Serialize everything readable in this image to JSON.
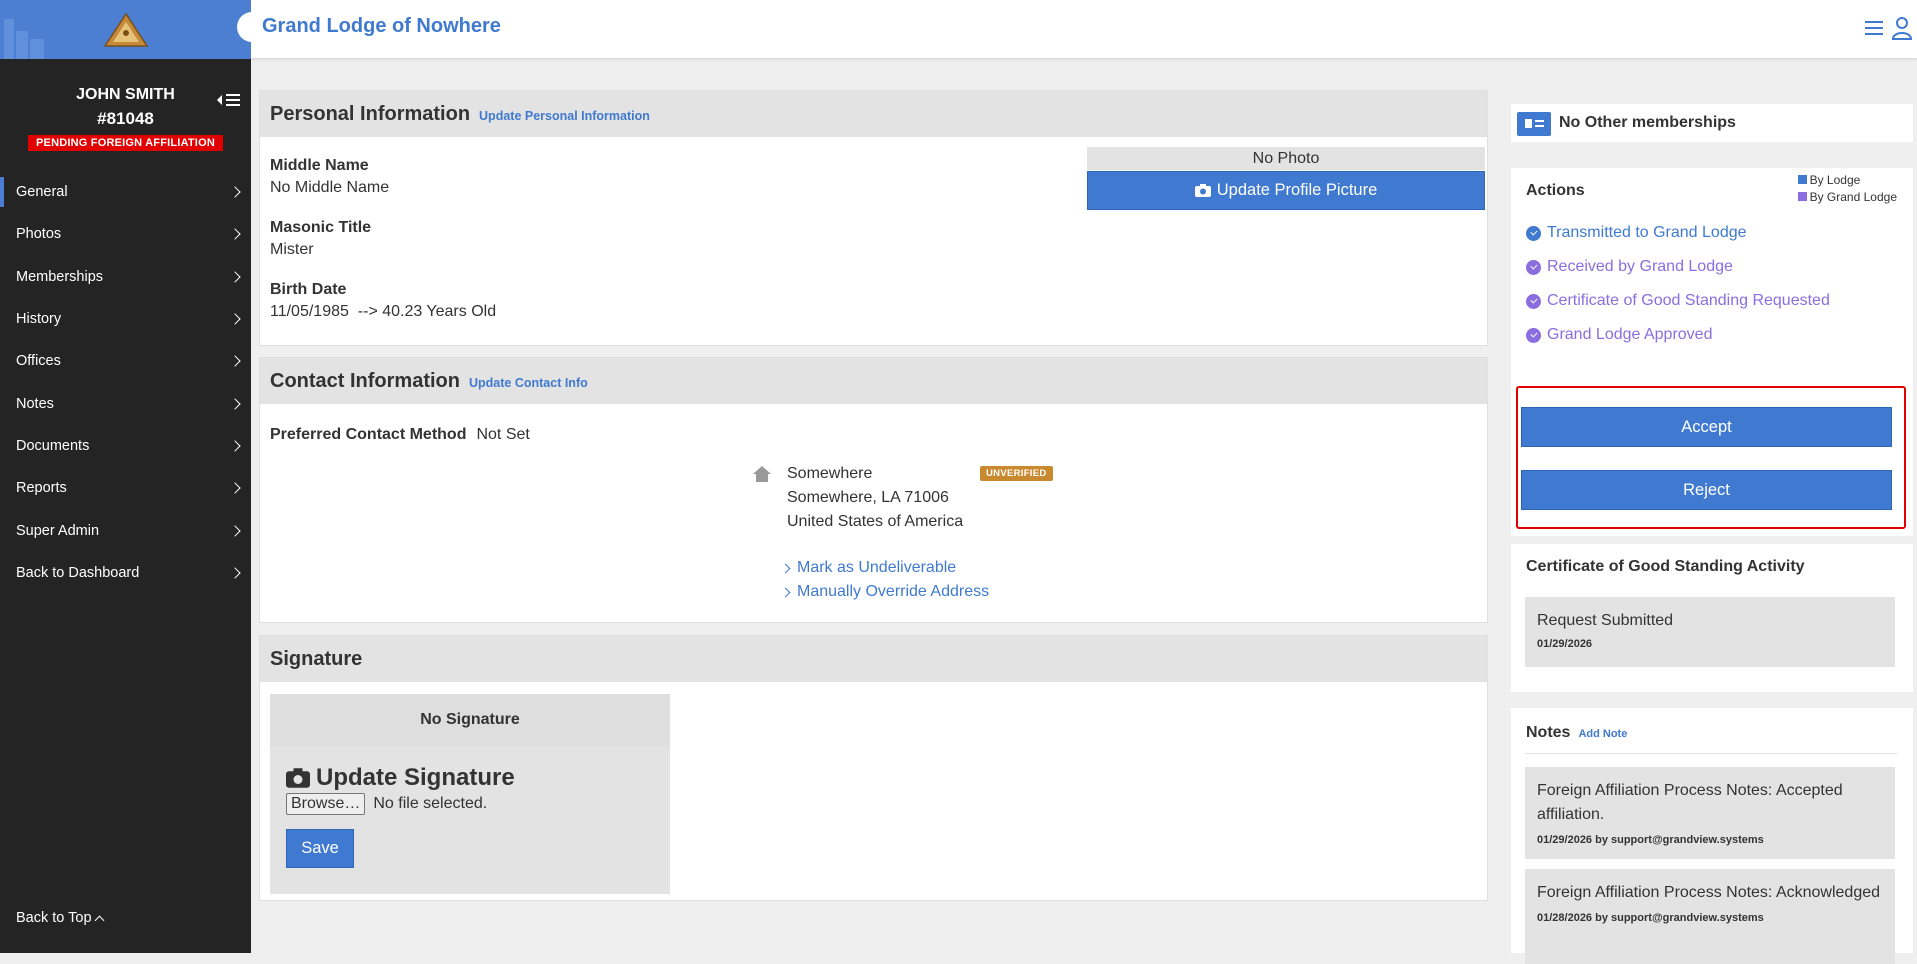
{
  "header": {
    "title": "Grand Lodge of Nowhere"
  },
  "user": {
    "name": "JOHN SMITH",
    "number": "#81048",
    "status_badge": "PENDING FOREIGN AFFILIATION"
  },
  "nav": [
    {
      "label": "General",
      "active": true
    },
    {
      "label": "Photos"
    },
    {
      "label": "Memberships"
    },
    {
      "label": "History"
    },
    {
      "label": "Offices"
    },
    {
      "label": "Notes"
    },
    {
      "label": "Documents"
    },
    {
      "label": "Reports"
    },
    {
      "label": "Super Admin"
    },
    {
      "label": "Back to Dashboard"
    }
  ],
  "back_to_top": "Back to Top",
  "personal": {
    "title": "Personal Information",
    "update_link": "Update Personal Information",
    "middle_name_label": "Middle Name",
    "middle_name_value": "No Middle Name",
    "masonic_title_label": "Masonic Title",
    "masonic_title_value": "Mister",
    "birth_date_label": "Birth Date",
    "birth_date_value": "11/05/1985  --> 40.23 Years Old",
    "photo_label": "No Photo",
    "photo_button": "Update Profile Picture"
  },
  "contact": {
    "title": "Contact Information",
    "update_link": "Update Contact Info",
    "preferred_label": "Preferred Contact Method",
    "preferred_value": "Not Set",
    "address_line1": "Somewhere",
    "address_line2": "Somewhere, LA 71006",
    "address_line3": "United States of America",
    "address_badge": "UNVERIFIED",
    "mark_undeliverable": "Mark as Undeliverable",
    "override_address": "Manually Override Address"
  },
  "signature": {
    "title": "Signature",
    "none_label": "No Signature",
    "update_label": "Update Signature",
    "browse_label": "Browse…",
    "file_status": "No file selected.",
    "save_label": "Save"
  },
  "memberships": {
    "label": "No Other memberships"
  },
  "actions": {
    "title": "Actions",
    "legend": [
      {
        "label": "By Lodge",
        "color": "#3f7ad0"
      },
      {
        "label": "By Grand Lodge",
        "color": "#8a6ee0"
      }
    ],
    "items": [
      {
        "label": "Transmitted to Grand Lodge",
        "color": "#3f7ad0"
      },
      {
        "label": "Received by Grand Lodge",
        "color": "#8a6ee0"
      },
      {
        "label": "Certificate of Good Standing Requested",
        "color": "#8a6ee0"
      },
      {
        "label": "Grand Lodge Approved",
        "color": "#8a6ee0"
      }
    ],
    "accept_label": "Accept",
    "reject_label": "Reject"
  },
  "cgs_activity": {
    "title": "Certificate of Good Standing Activity",
    "entries": [
      {
        "title": "Request Submitted",
        "date": "01/29/2026"
      }
    ]
  },
  "notes": {
    "title": "Notes",
    "add_link": "Add Note",
    "entries": [
      {
        "text": "Foreign Affiliation Process Notes: Accepted affiliation.",
        "meta": "01/29/2026 by support@grandview.systems"
      },
      {
        "text": "Foreign Affiliation Process Notes: Acknowledged",
        "meta": "01/28/2026 by support@grandview.systems"
      }
    ]
  },
  "colors": {
    "accent": "#3f7ad0",
    "grand_lodge": "#8a6ee0",
    "badge_red": "#e00000",
    "sidebar_bg": "#242424"
  }
}
